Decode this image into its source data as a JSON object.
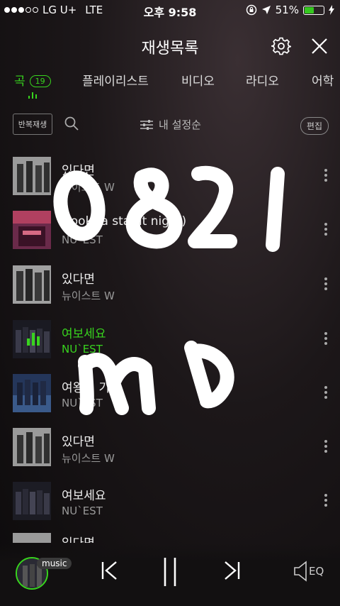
{
  "status": {
    "carrier": "LG U+",
    "network": "LTE",
    "time": "오후 9:58",
    "battery_pct": "51%",
    "battery_level": 0.51,
    "signal_dots_filled": 3,
    "signal_dots_total": 5
  },
  "header": {
    "title": "재생목록",
    "settings_icon": "gear-icon",
    "close_icon": "close-icon"
  },
  "tabs": [
    {
      "label": "곡",
      "count": "19",
      "active": true
    },
    {
      "label": "플레이리스트"
    },
    {
      "label": "비디오"
    },
    {
      "label": "라디오"
    },
    {
      "label": "어학"
    }
  ],
  "toolbar": {
    "repeat_label": "반복재생",
    "sort_label": "내 설정순",
    "edit_label": "편집"
  },
  "tracks": [
    {
      "title": "있다면",
      "artist": "뉴이스트 W"
    },
    {
      "title": "Hook (a starlit night)",
      "artist": "NU`EST"
    },
    {
      "title": "있다면",
      "artist": "뉴이스트 W"
    },
    {
      "title": "여보세요",
      "artist": "NU`EST",
      "playing": true
    },
    {
      "title": "여왕의 기사",
      "artist": "NU`EST"
    },
    {
      "title": "있다면",
      "artist": "뉴이스트 W"
    },
    {
      "title": "여보세요",
      "artist": "NU`EST"
    },
    {
      "title": "있다면",
      "artist": ""
    }
  ],
  "overlay_text": {
    "line1": "0821",
    "line2": "MD"
  },
  "player": {
    "badge": "music",
    "eq_label": "EQ"
  },
  "colors": {
    "accent": "#38d41e",
    "text_secondary": "#999999",
    "background": "#1c1719"
  }
}
